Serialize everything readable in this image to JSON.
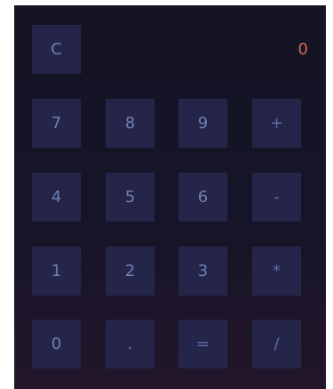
{
  "display": {
    "value": "0"
  },
  "keys": {
    "clear": "C",
    "row1": [
      "7",
      "8",
      "9",
      "+"
    ],
    "row2": [
      "4",
      "5",
      "6",
      "-"
    ],
    "row3": [
      "1",
      "2",
      "3",
      "*"
    ],
    "row4": [
      "0",
      ".",
      "=",
      "/"
    ]
  },
  "colors": {
    "background_top": "#141424",
    "background_bottom": "#22162a",
    "key_background": "#25254a",
    "key_text": "#6f7fb0",
    "display_text": "#d26a4f"
  }
}
